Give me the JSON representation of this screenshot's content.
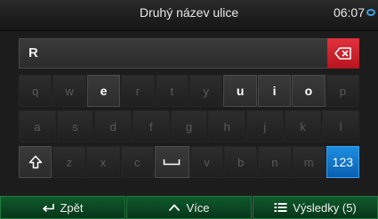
{
  "header": {
    "title": "Druhý název ulice",
    "time": "06:07"
  },
  "input": {
    "value": "R"
  },
  "keyboard": {
    "row1": [
      "q",
      "w",
      "e",
      "r",
      "t",
      "y",
      "u",
      "i",
      "o",
      "p"
    ],
    "row2": [
      "a",
      "s",
      "d",
      "f",
      "g",
      "h",
      "j",
      "k",
      "l"
    ],
    "row3": [
      "z",
      "x",
      "c",
      "v",
      "b",
      "n",
      "m"
    ],
    "numbers_label": "123"
  },
  "footer": {
    "back_label": "Zpět",
    "more_label": "Více",
    "results_label": "Výsledky (5)"
  },
  "colors": {
    "accent_red": "#d42a33",
    "accent_blue": "#1677d2",
    "footer_green": "#0c4a24"
  },
  "icons": {
    "backspace": "backspace-icon",
    "shift": "shift-icon",
    "space": "space-icon",
    "back": "back-arrow-icon",
    "more": "chevron-up-icon",
    "results": "list-icon"
  }
}
